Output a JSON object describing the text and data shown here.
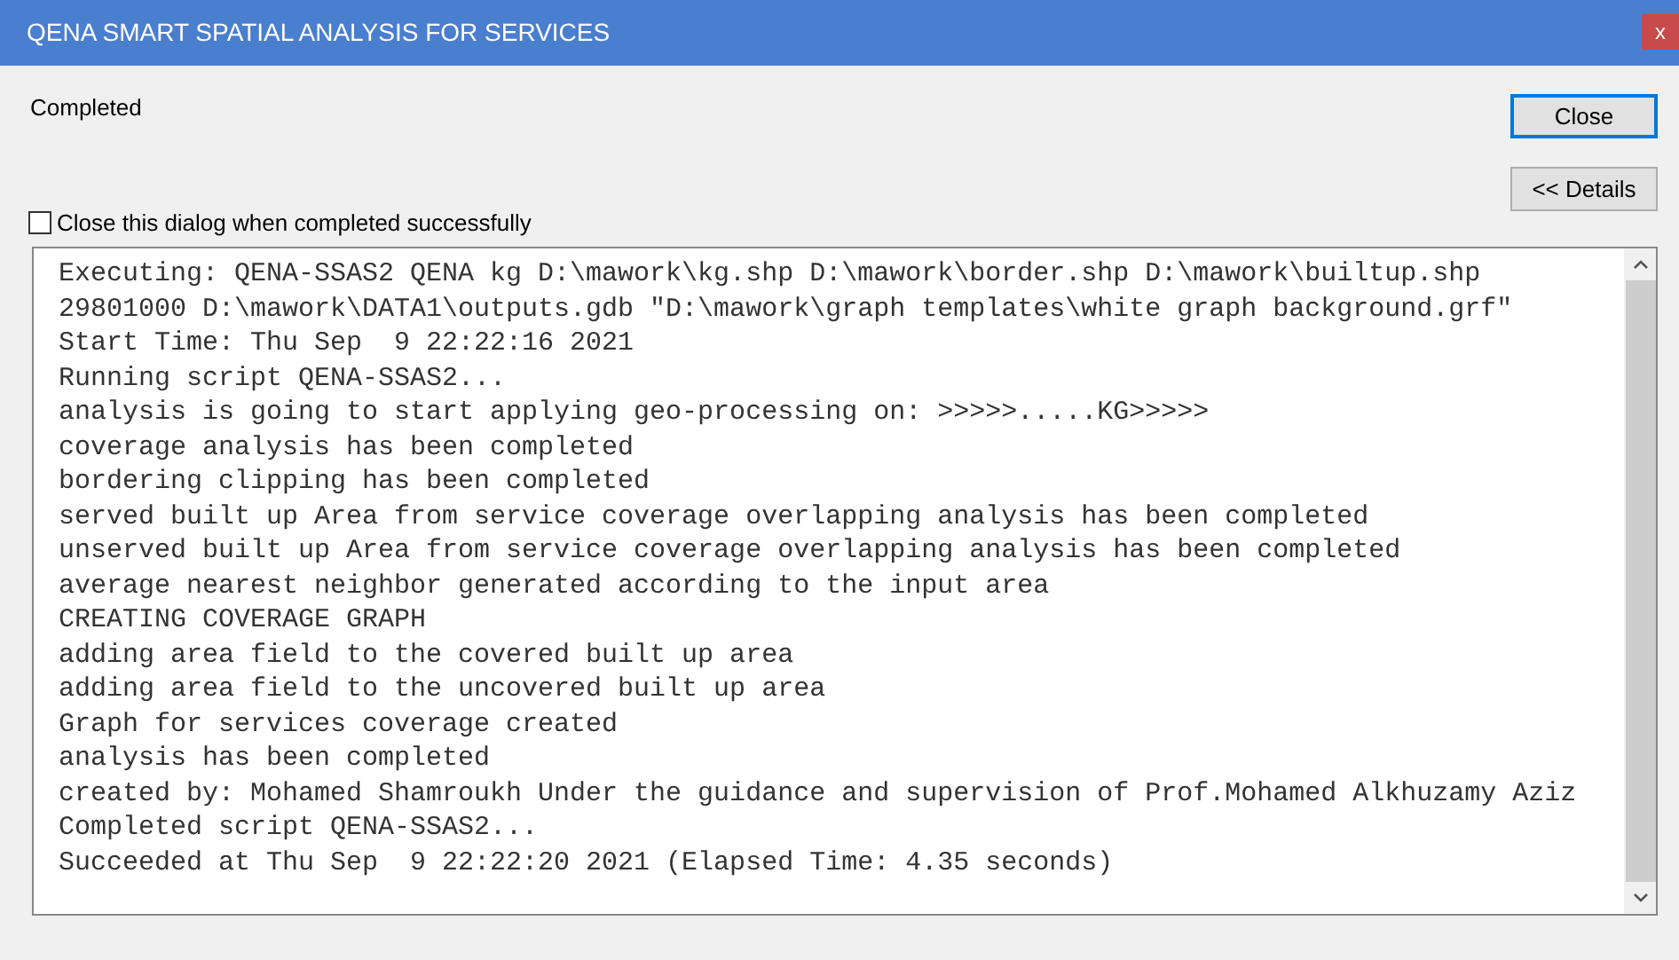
{
  "window": {
    "title": "QENA SMART SPATIAL ANALYSIS FOR SERVICES",
    "close_glyph": "x"
  },
  "status": "Completed",
  "buttons": [
    {
      "label": "Close",
      "kind": "default"
    },
    {
      "label": "<< Details",
      "kind": "normal"
    }
  ],
  "close_when_done": {
    "label": "Close this dialog when completed successfully",
    "checked": false
  },
  "log_lines": [
    "Executing: QENA-SSAS2 QENA kg D:\\mawork\\kg.shp D:\\mawork\\border.shp D:\\mawork\\builtup.shp",
    "29801000 D:\\mawork\\DATA1\\outputs.gdb \"D:\\mawork\\graph templates\\white graph background.grf\"",
    "Start Time: Thu Sep  9 22:22:16 2021",
    "Running script QENA-SSAS2...",
    "analysis is going to start applying geo-processing on: >>>>>.....KG>>>>>",
    "coverage analysis has been completed",
    "bordering clipping has been completed",
    "served built up Area from service coverage overlapping analysis has been completed",
    "unserved built up Area from service coverage overlapping analysis has been completed",
    "average nearest neighbor generated according to the input area",
    "CREATING COVERAGE GRAPH",
    "adding area field to the covered built up area",
    "adding area field to the uncovered built up area",
    "Graph for services coverage created",
    "analysis has been completed",
    "created by: Mohamed Shamroukh Under the guidance and supervision of Prof.Mohamed Alkhuzamy Aziz",
    "Completed script QENA-SSAS2...",
    "Succeeded at Thu Sep  9 22:22:20 2021 (Elapsed Time: 4.35 seconds)"
  ]
}
